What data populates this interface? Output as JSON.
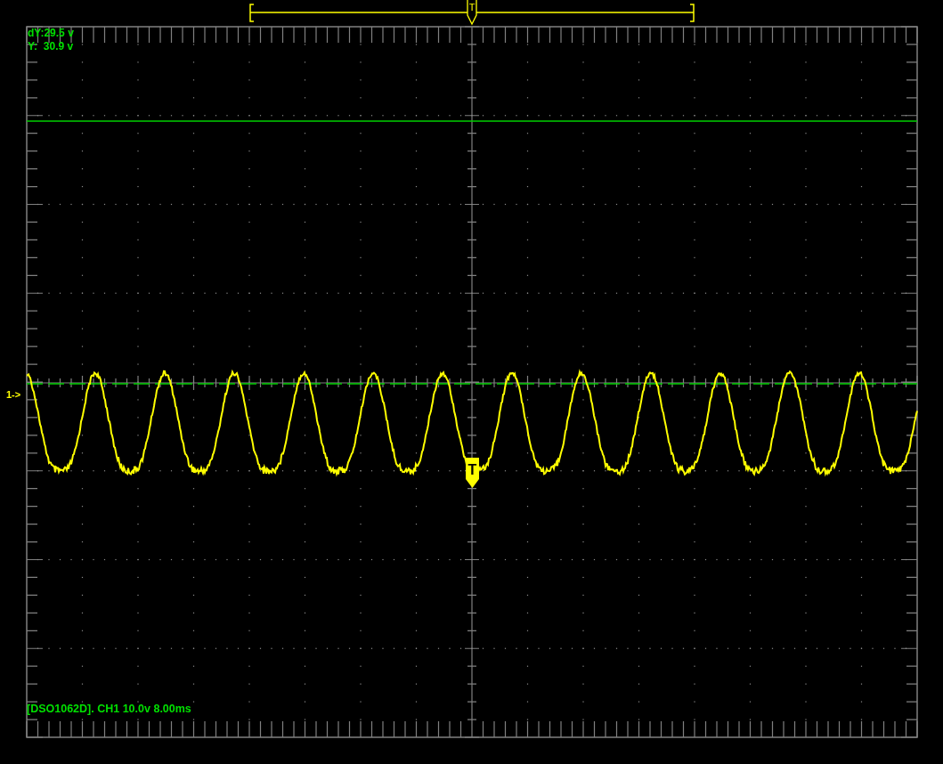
{
  "readouts": [
    "dY:29.5 v",
    "Y:  30.9 v"
  ],
  "channel_marker": "1->",
  "trigger_position_marker": "T",
  "trigger_marker": "T",
  "status": "[DSO1062D]. CH1 10.0v 8.00ms"
}
